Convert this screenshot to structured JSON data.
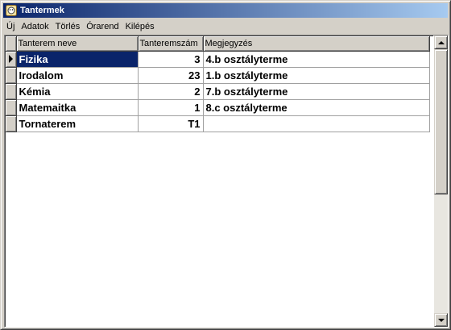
{
  "window": {
    "title": "Tantermek",
    "icon": "app-icon"
  },
  "menu": {
    "items": [
      "Új",
      "Adatok",
      "Törlés",
      "Órarend",
      "Kilépés"
    ]
  },
  "grid": {
    "columns": [
      "Tanterem neve",
      "Tanteremszám",
      "Megjegyzés"
    ],
    "rows": [
      {
        "name": "Fizika",
        "number": "3",
        "note": "4.b osztályterme",
        "selected": true
      },
      {
        "name": "Irodalom",
        "number": "23",
        "note": "1.b osztályterme",
        "selected": false
      },
      {
        "name": "Kémia",
        "number": "2",
        "note": "7.b osztályterme",
        "selected": false
      },
      {
        "name": "Matemaitka",
        "number": "1",
        "note": "8.c osztályterme",
        "selected": false
      },
      {
        "name": "Tornaterem",
        "number": "T1",
        "note": "",
        "selected": false
      }
    ]
  },
  "colors": {
    "titlebar_start": "#0a246a",
    "titlebar_end": "#a6caf0",
    "selection": "#0a246a",
    "face": "#d4d0c8"
  }
}
